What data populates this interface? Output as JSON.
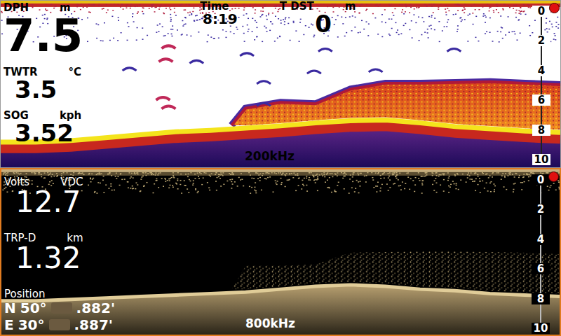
{
  "panels": [
    {
      "frequency": "200kHz",
      "palette": "color",
      "recording": true,
      "header": [
        {
          "label": "Time",
          "unit": "",
          "value": "8:19",
          "size": "sm"
        },
        {
          "label": "T DST",
          "unit": "m",
          "value": "0",
          "size": "md"
        }
      ],
      "readouts": [
        {
          "kind": "value",
          "label": "DPH",
          "unit": "m",
          "value": "7.5",
          "size": "xl"
        },
        {
          "kind": "value",
          "label": "TWTR",
          "unit": "°C",
          "value": "3.5",
          "size": "md"
        },
        {
          "kind": "value",
          "label": "SOG",
          "unit": "kph",
          "value": "3.52",
          "size": "md"
        }
      ],
      "scale": [
        "0",
        "2",
        "4",
        "6",
        "8",
        "10"
      ],
      "bottom_depth": [
        8.9,
        8.9,
        8.8,
        8.6,
        8.4,
        8.2,
        8.1,
        7.95,
        7.8,
        7.6,
        7.45,
        7.4,
        7.6,
        7.85,
        8.0,
        8.15,
        8.25
      ],
      "school": {
        "from": 7,
        "top": [
          6.6,
          6.2,
          6.3,
          5.3,
          4.9,
          4.9,
          4.85,
          4.8,
          4.9,
          5.0
        ]
      },
      "fish": [
        {
          "pos": 0.3,
          "depth": 2.4,
          "strong": true
        },
        {
          "pos": 0.295,
          "depth": 3.3,
          "strong": true
        },
        {
          "pos": 0.29,
          "depth": 5.9,
          "strong": true
        },
        {
          "pos": 0.3,
          "depth": 6.5,
          "strong": true
        },
        {
          "pos": 0.23,
          "depth": 3.9,
          "strong": false
        },
        {
          "pos": 0.35,
          "depth": 3.4,
          "strong": false
        },
        {
          "pos": 0.44,
          "depth": 2.9,
          "strong": false
        },
        {
          "pos": 0.47,
          "depth": 4.8,
          "strong": false
        },
        {
          "pos": 0.56,
          "depth": 4.1,
          "strong": false
        },
        {
          "pos": 0.58,
          "depth": 2.6,
          "strong": false
        },
        {
          "pos": 0.67,
          "depth": 4.0,
          "strong": false
        },
        {
          "pos": 0.81,
          "depth": 2.6,
          "strong": false
        },
        {
          "pos": 0.47,
          "depth": 6.3,
          "strong": false
        }
      ]
    },
    {
      "frequency": "800kHz",
      "palette": "mono",
      "recording": true,
      "header": [],
      "readouts": [
        {
          "kind": "value",
          "label": "Volts",
          "unit": "VDC",
          "value": "12.7",
          "size": "lg"
        },
        {
          "kind": "value",
          "label": "TRP-D",
          "unit": "km",
          "value": "1.32",
          "size": "lg"
        },
        {
          "kind": "position",
          "label": "Position",
          "lines": [
            {
              "hemisphere": "N",
              "degrees": "50°",
              "minutes": ".882'"
            },
            {
              "hemisphere": "E",
              "degrees": "30°",
              "minutes": ".887'"
            }
          ]
        }
      ],
      "scale": [
        "0",
        "2",
        "4",
        "6",
        "8",
        "10"
      ],
      "bottom_depth": [
        8.3,
        8.3,
        8.2,
        8.1,
        8.0,
        7.9,
        7.8,
        7.7,
        7.5,
        7.3,
        7.2,
        7.3,
        7.5,
        7.6,
        7.8,
        7.9,
        8.0
      ],
      "school": {
        "from": 7,
        "top": [
          5.9,
          5.9,
          5.8,
          5.0,
          4.95,
          4.9,
          4.9,
          4.95,
          5.0,
          5.1
        ]
      },
      "fish": []
    }
  ]
}
